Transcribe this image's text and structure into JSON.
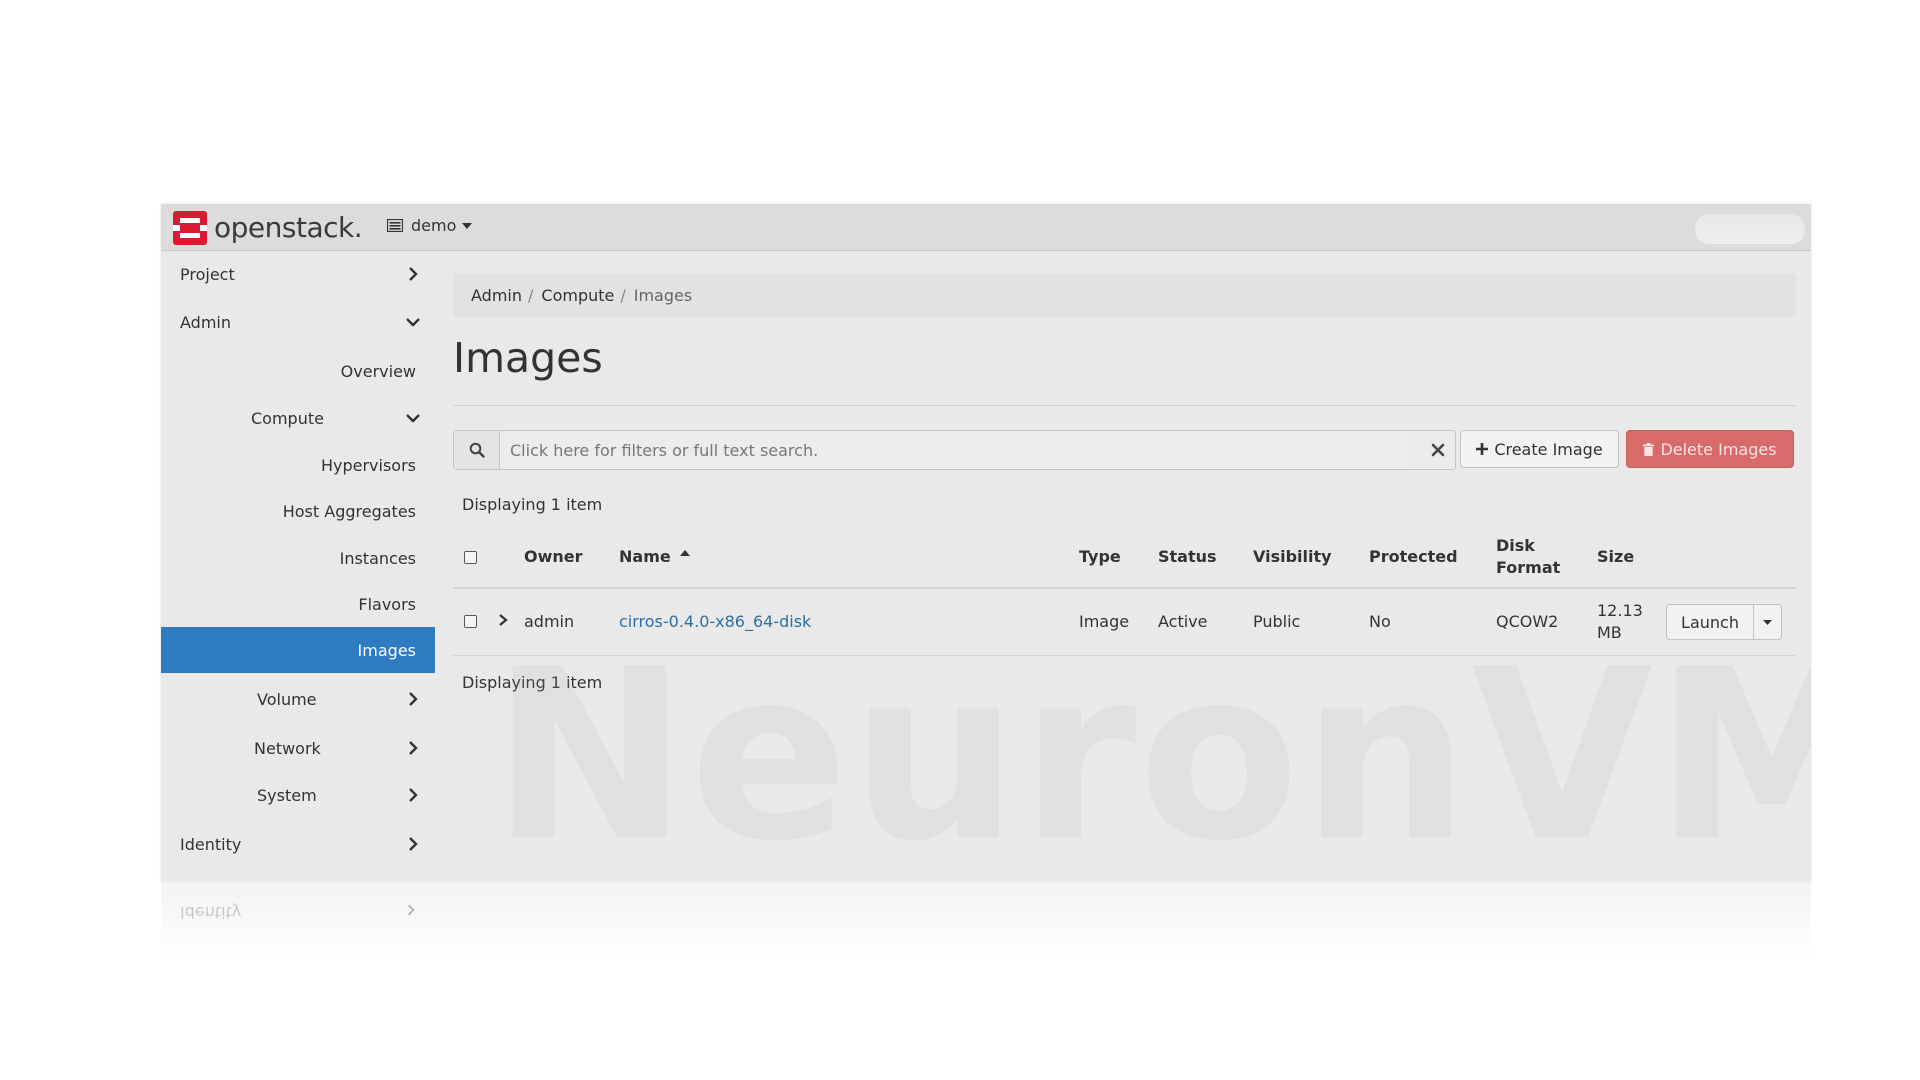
{
  "navbar": {
    "brand": "openstack.",
    "project": "demo"
  },
  "sidebar": {
    "items": [
      {
        "label": "Project",
        "chevron": "right"
      },
      {
        "label": "Admin",
        "chevron": "down"
      },
      {
        "label": "Overview"
      },
      {
        "label": "Compute",
        "chevron": "down"
      },
      {
        "label": "Hypervisors"
      },
      {
        "label": "Host Aggregates"
      },
      {
        "label": "Instances"
      },
      {
        "label": "Flavors"
      },
      {
        "label": "Images",
        "active": true
      },
      {
        "label": "Volume",
        "chevron": "right"
      },
      {
        "label": "Network",
        "chevron": "right"
      },
      {
        "label": "System",
        "chevron": "right"
      },
      {
        "label": "Identity",
        "chevron": "right"
      }
    ]
  },
  "breadcrumb": [
    "Admin",
    "Compute",
    "Images"
  ],
  "page": {
    "title": "Images"
  },
  "toolbar": {
    "search_placeholder": "Click here for filters or full text search.",
    "create_label": "Create Image",
    "delete_label": "Delete Images"
  },
  "table": {
    "count_top": "Displaying 1 item",
    "count_bottom": "Displaying 1 item",
    "headers": {
      "owner": "Owner",
      "name": "Name",
      "type": "Type",
      "status": "Status",
      "visibility": "Visibility",
      "protected": "Protected",
      "disk_format_1": "Disk",
      "disk_format_2": "Format",
      "size": "Size"
    },
    "sort": {
      "column": "Name",
      "direction": "ascending"
    },
    "rows": [
      {
        "owner": "admin",
        "name": "cirros-0.4.0-x86_64-disk",
        "type": "Image",
        "status": "Active",
        "visibility": "Public",
        "protected": "No",
        "disk_format": "QCOW2",
        "size_1": "12.13",
        "size_2": "MB",
        "action": "Launch"
      }
    ]
  },
  "watermark": "NeuronVM",
  "colors": {
    "accent": "#2f7bc0",
    "danger": "#d86a6a",
    "link": "#2f6ea5",
    "brand_red": "#da1a32"
  }
}
